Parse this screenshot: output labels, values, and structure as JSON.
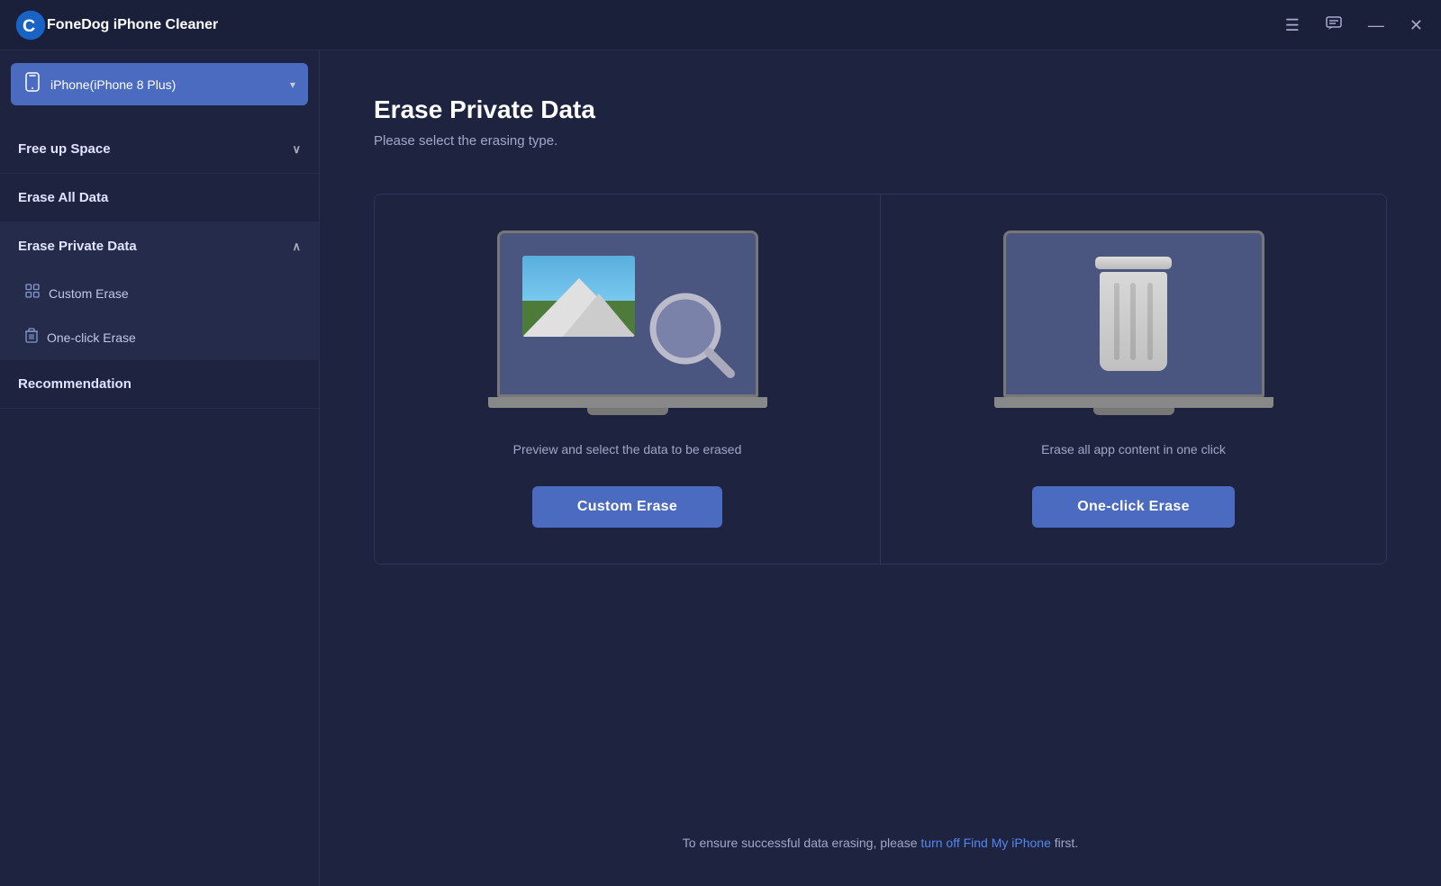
{
  "app": {
    "title": "FoneDog iPhone Cleaner",
    "titlebar_controls": {
      "menu_icon": "☰",
      "chat_icon": "💬",
      "minimize_icon": "—",
      "close_icon": "✕"
    }
  },
  "sidebar": {
    "device": {
      "name": "iPhone(iPhone 8 Plus)",
      "icon": "📱"
    },
    "nav_items": [
      {
        "id": "free-up-space",
        "label": "Free up Space",
        "has_arrow": true,
        "collapsed": true
      },
      {
        "id": "erase-all-data",
        "label": "Erase All Data",
        "has_arrow": false,
        "collapsed": true
      },
      {
        "id": "erase-private-data",
        "label": "Erase Private Data",
        "has_arrow": true,
        "expanded": true,
        "sub_items": [
          {
            "id": "custom-erase",
            "label": "Custom Erase",
            "icon": "⊞"
          },
          {
            "id": "one-click-erase",
            "label": "One-click Erase",
            "icon": "🗑"
          }
        ]
      },
      {
        "id": "recommendation",
        "label": "Recommendation",
        "has_arrow": false,
        "collapsed": true
      }
    ]
  },
  "content": {
    "title": "Erase Private Data",
    "subtitle": "Please select the erasing type.",
    "cards": [
      {
        "id": "custom-erase-card",
        "description": "Preview and select the data to be erased",
        "button_label": "Custom Erase"
      },
      {
        "id": "one-click-erase-card",
        "description": "Erase all app content in one click",
        "button_label": "One-click Erase"
      }
    ],
    "bottom_note_prefix": "To ensure successful data erasing, please ",
    "bottom_note_link": "turn off Find My iPhone",
    "bottom_note_suffix": " first."
  }
}
